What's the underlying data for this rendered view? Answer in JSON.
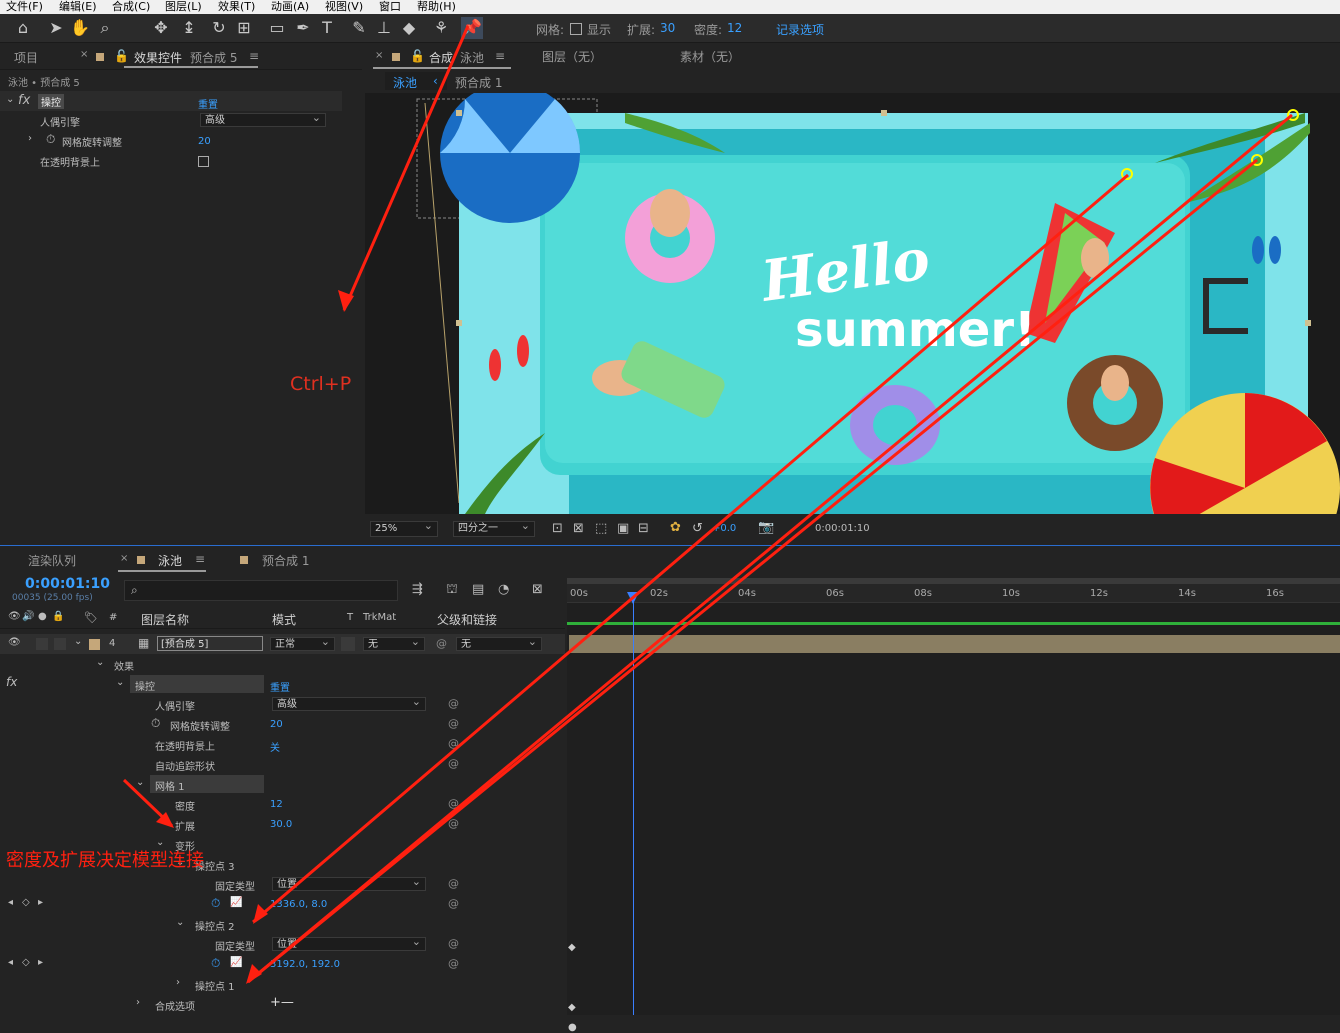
{
  "menu": [
    "文件(F)",
    "编辑(E)",
    "合成(C)",
    "图层(L)",
    "效果(T)",
    "动画(A)",
    "视图(V)",
    "窗口",
    "帮助(H)"
  ],
  "toolbar": {
    "grid_label": "网格:",
    "show_label": "显示",
    "expand_label": "扩展:",
    "expand_value": "30",
    "density_label": "密度:",
    "density_value": "12",
    "record_label": "记录选项"
  },
  "effect_panel": {
    "tab_project": "项目",
    "tab_effects_prefix": "效果控件",
    "tab_effects_comp": "预合成 5",
    "breadcrumb": "泳池 • 预合成 5",
    "fx_label": "fx",
    "effect_name": "操控",
    "reset": "重置",
    "props": [
      {
        "label": "人偶引擎",
        "value": "高级"
      },
      {
        "label": "网格旋转调整",
        "value": "20"
      },
      {
        "label": "在透明背景上",
        "value": ""
      }
    ]
  },
  "comp_panel": {
    "tab_comp_prefix": "合成",
    "tab_comp_name": "泳池",
    "tab_layer": "图层（无）",
    "tab_footage": "素材（无）",
    "crumb1": "泳池",
    "crumb2": "预合成 1",
    "zoom": "25%",
    "resolution": "四分之一",
    "exposure": "+0.0",
    "timecode": "0:00:01:10",
    "art_line1": "Hello",
    "art_line2": "summer!"
  },
  "annotations": {
    "shortcut": "Ctrl+P",
    "note": "密度及扩展决定模型连接"
  },
  "timeline": {
    "tab_render": "渲染队列",
    "tab_pool": "泳池",
    "tab_precomp": "预合成 1",
    "timecode": "0:00:01:10",
    "fps": "00035 (25.00 fps)",
    "col_hash": "#",
    "col_name": "图层名称",
    "col_mode": "模式",
    "col_t": "T",
    "col_trkmat": "TrkMat",
    "col_parent": "父级和链接",
    "layer_num": "4",
    "layer_name": "[预合成 5]",
    "layer_mode": "正常",
    "layer_trkmat": "无",
    "layer_parent": "无",
    "ruler": [
      "00s",
      "02s",
      "04s",
      "06s",
      "08s",
      "10s",
      "12s",
      "14s",
      "16s"
    ],
    "rows": [
      {
        "label": "效果",
        "value": ""
      },
      {
        "label": "操控",
        "value": "重置"
      },
      {
        "label": "人偶引擎",
        "value": "高级"
      },
      {
        "label": "网格旋转调整",
        "value": "20"
      },
      {
        "label": "在透明背景上",
        "value": "关"
      },
      {
        "label": "自动追踪形状",
        "value": ""
      },
      {
        "label": "网格 1",
        "value": ""
      },
      {
        "label": "密度",
        "value": "12"
      },
      {
        "label": "扩展",
        "value": "30.0"
      },
      {
        "label": "变形",
        "value": ""
      },
      {
        "label": "操控点 3",
        "value": ""
      },
      {
        "label": "固定类型",
        "value": "位置"
      },
      {
        "label": "",
        "value": "1336.0, 8.0"
      },
      {
        "label": "操控点 2",
        "value": ""
      },
      {
        "label": "固定类型",
        "value": "位置"
      },
      {
        "label": "",
        "value": "3192.0, 192.0"
      },
      {
        "label": "操控点 1",
        "value": ""
      },
      {
        "label": "合成选项",
        "value": "+—"
      }
    ]
  }
}
